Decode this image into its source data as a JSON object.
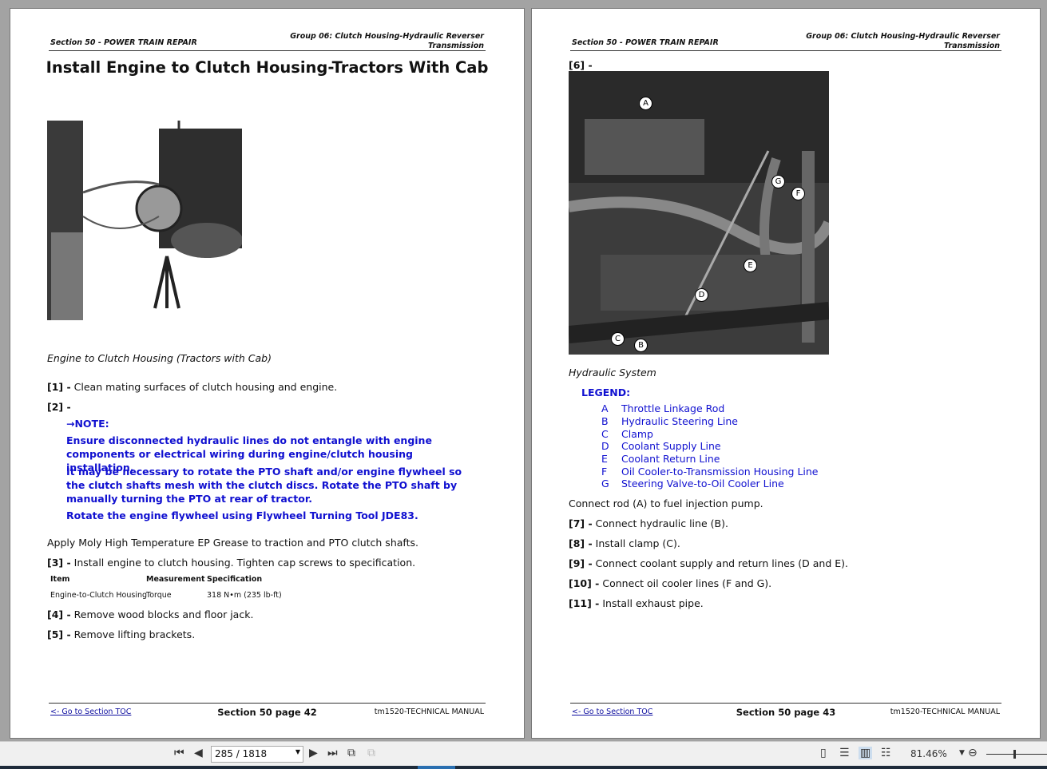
{
  "left_page": {
    "header_left": "Section 50 - POWER TRAIN REPAIR",
    "header_right_1": "Group 06: Clutch Housing-Hydraulic Reverser",
    "header_right_2": "Transmission",
    "title": "Install Engine to Clutch Housing-Tractors With Cab",
    "caption": "Engine to Clutch Housing (Tractors with Cab)",
    "step1_num": "[1] -",
    "step1": "Clean mating surfaces of clutch housing and engine.",
    "step2_num": "[2] -",
    "note_label": "→NOTE:",
    "note_1": "Ensure disconnected hydraulic lines do not entangle with engine components or electrical wiring during engine/clutch housing installation.",
    "note_2": "It may be necessary to rotate the PTO shaft and/or engine flywheel so the clutch shafts mesh with the clutch discs. Rotate the PTO shaft by manually turning the PTO at rear of tractor.",
    "note_3": "Rotate the engine flywheel using Flywheel Turning Tool JDE83.",
    "grease": "Apply Moly High Temperature EP Grease to traction and PTO clutch shafts.",
    "step3_num": "[3] -",
    "step3": "Install engine to clutch housing. Tighten cap screws to specification.",
    "table": {
      "headers": [
        "Item",
        "Measurement",
        "Specification"
      ],
      "row": [
        "Engine-to-Clutch Housing",
        "Torque",
        "318 N•m (235 lb-ft)"
      ]
    },
    "step4_num": "[4] -",
    "step4": "Remove wood blocks and floor jack.",
    "step5_num": "[5] -",
    "step5": "Remove lifting brackets.",
    "footer_link": "<- Go to Section TOC",
    "footer_center": "Section 50 page 42",
    "footer_right": "tm1520-TECHNICAL MANUAL"
  },
  "right_page": {
    "header_left": "Section 50 - POWER TRAIN REPAIR",
    "header_right_1": "Group 06: Clutch Housing-Hydraulic Reverser",
    "header_right_2": "Transmission",
    "step6_num": "[6] -",
    "callouts": [
      "A",
      "B",
      "C",
      "D",
      "E",
      "F",
      "G"
    ],
    "caption": "Hydraulic System",
    "legend_title": "LEGEND:",
    "legend": [
      {
        "k": "A",
        "v": "Throttle Linkage Rod"
      },
      {
        "k": "B",
        "v": "Hydraulic Steering Line"
      },
      {
        "k": "C",
        "v": "Clamp"
      },
      {
        "k": "D",
        "v": "Coolant Supply Line"
      },
      {
        "k": "E",
        "v": "Coolant Return Line"
      },
      {
        "k": "F",
        "v": "Oil Cooler-to-Transmission Housing Line"
      },
      {
        "k": "G",
        "v": "Steering Valve-to-Oil Cooler Line"
      }
    ],
    "connect_rod": "Connect rod (A) to fuel injection pump.",
    "step7_num": "[7] -",
    "step7": "Connect hydraulic line (B).",
    "step8_num": "[8] -",
    "step8": "Install clamp (C).",
    "step9_num": "[9] -",
    "step9": "Connect coolant supply and return lines (D and E).",
    "step10_num": "[10] -",
    "step10": "Connect oil cooler lines (F and G).",
    "step11_num": "[11] -",
    "step11": "Install exhaust pipe.",
    "footer_link": "<- Go to Section TOC",
    "footer_center": "Section 50 page 43",
    "footer_right": "tm1520-TECHNICAL MANUAL"
  },
  "toolbar": {
    "page_value": "285 / 1818",
    "zoom": "81.46%",
    "zoom_progress": 0.7
  }
}
